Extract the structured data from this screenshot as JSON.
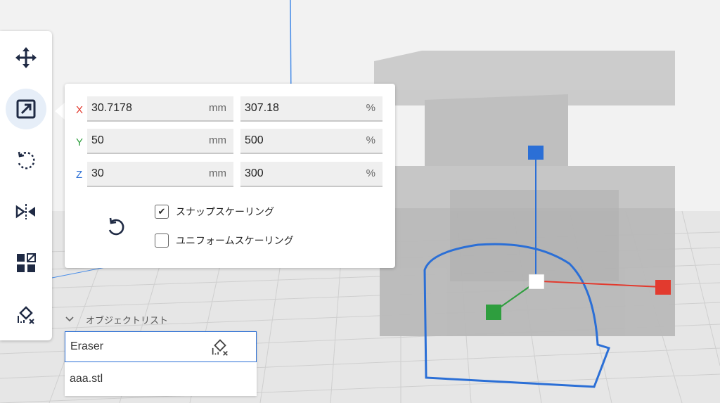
{
  "toolbar": {
    "tools": [
      {
        "name": "move-tool",
        "icon": "move-arrows-icon",
        "active": false
      },
      {
        "name": "scale-tool",
        "icon": "scale-icon",
        "active": true
      },
      {
        "name": "rotate-tool",
        "icon": "rotate-icon",
        "active": false
      },
      {
        "name": "mirror-tool",
        "icon": "mirror-icon",
        "active": false
      },
      {
        "name": "per-model-settings-tool",
        "icon": "per-model-settings-icon",
        "active": false
      },
      {
        "name": "support-blocker-tool",
        "icon": "eraser-icon",
        "active": false
      }
    ]
  },
  "scale_panel": {
    "rows": [
      {
        "axis": "X",
        "axis_color": "#e23a2e",
        "mm_value": "30.7178",
        "mm_unit": "mm",
        "pct_value": "307.18",
        "pct_unit": "%"
      },
      {
        "axis": "Y",
        "axis_color": "#2e9e3e",
        "mm_value": "50",
        "mm_unit": "mm",
        "pct_value": "500",
        "pct_unit": "%"
      },
      {
        "axis": "Z",
        "axis_color": "#2b6fd6",
        "mm_value": "30",
        "mm_unit": "mm",
        "pct_value": "300",
        "pct_unit": "%"
      }
    ],
    "snap_scaling": {
      "label": "スナップスケーリング",
      "checked": true
    },
    "uniform_scaling": {
      "label": "ユニフォームスケーリング",
      "checked": false
    },
    "reset_icon": "reset-icon"
  },
  "object_list": {
    "title": "オブジェクトリスト",
    "items": [
      {
        "name": "Eraser",
        "selected": true,
        "icon": "eraser-icon"
      },
      {
        "name": "aaa.stl",
        "selected": false
      }
    ]
  },
  "colors": {
    "accent": "#2b6fd6",
    "x_axis": "#e23a2e",
    "y_axis": "#2e9e3e",
    "z_axis": "#2b6fd6"
  }
}
